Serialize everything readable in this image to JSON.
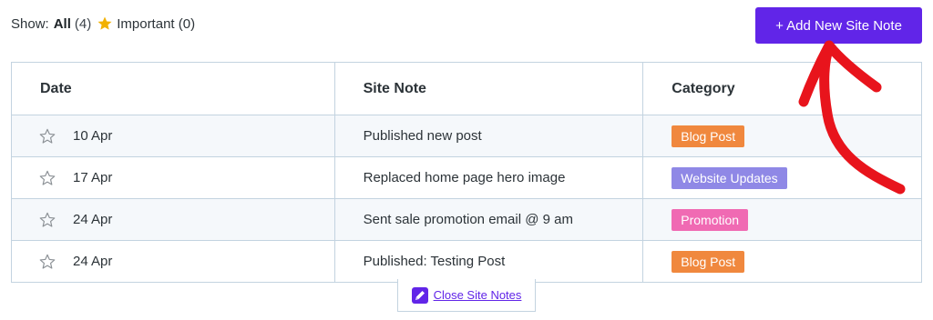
{
  "filter": {
    "show_label": "Show:",
    "all_label": "All",
    "all_count": "(4)",
    "important_label": "Important",
    "important_count": "(0)",
    "star_icon": "star-filled-icon"
  },
  "actions": {
    "add_note_label": "+ Add New Site Note"
  },
  "table": {
    "headers": {
      "date": "Date",
      "note": "Site Note",
      "category": "Category"
    },
    "rows": [
      {
        "date": "10 Apr",
        "note": "Published new post",
        "category": "Blog Post",
        "category_color": "#f0883e"
      },
      {
        "date": "17 Apr",
        "note": "Replaced home page hero image",
        "category": "Website Updates",
        "category_color": "#8f88e6"
      },
      {
        "date": "24 Apr",
        "note": "Sent sale promotion email @ 9 am",
        "category": "Promotion",
        "category_color": "#f06ab3"
      },
      {
        "date": "24 Apr",
        "note": "Published: Testing Post",
        "category": "Blog Post",
        "category_color": "#f0883e"
      }
    ]
  },
  "footer": {
    "close_label": "Close Site Notes",
    "close_icon": "pencil-note-icon"
  },
  "colors": {
    "accent": "#6125e8",
    "annotation_arrow": "#e8141c",
    "star": "#f2b100"
  }
}
